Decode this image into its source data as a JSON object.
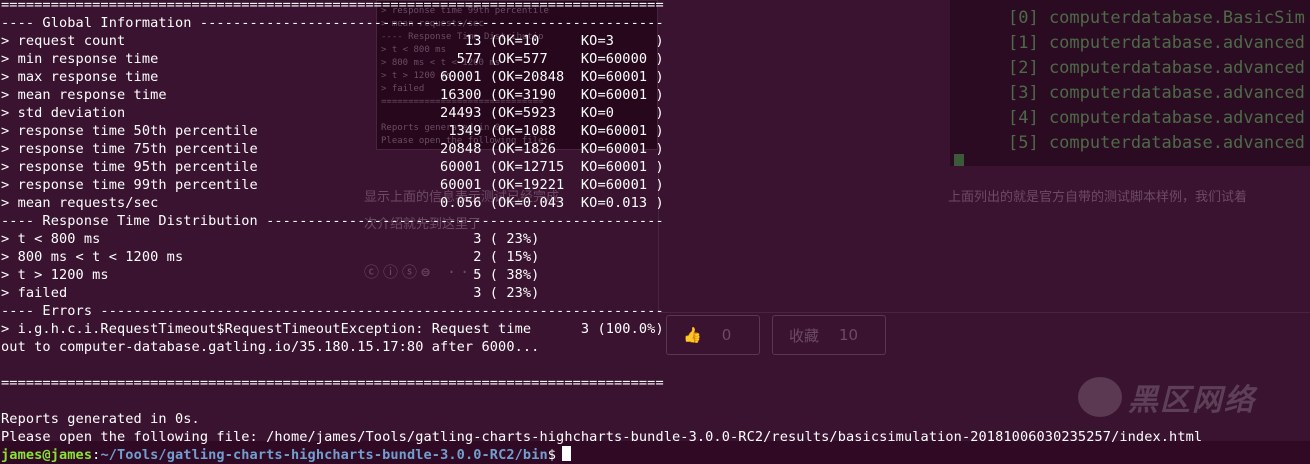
{
  "terminal": {
    "lines": [
      "================================================================================",
      "---- Global Information --------------------------------------------------------",
      "> request count                                         13 (OK=10     KO=3     )",
      "> min response time                                    577 (OK=577    KO=60000 )",
      "> max response time                                  60001 (OK=20848  KO=60001 )",
      "> mean response time                                 16300 (OK=3190   KO=60001 )",
      "> std deviation                                      24493 (OK=5923   KO=0     )",
      "> response time 50th percentile                       1349 (OK=1088   KO=60001 )",
      "> response time 75th percentile                      20848 (OK=1826   KO=60001 )",
      "> response time 95th percentile                      60001 (OK=12715  KO=60001 )",
      "> response time 99th percentile                      60001 (OK=19221  KO=60001 )",
      "> mean requests/sec                                  0.056 (OK=0.043  KO=0.013 )",
      "---- Response Time Distribution ------------------------------------------------",
      "> t < 800 ms                                             3 ( 23%)",
      "> 800 ms < t < 1200 ms                                   2 ( 15%)",
      "> t > 1200 ms                                            5 ( 38%)",
      "> failed                                                 3 ( 23%)",
      "---- Errors --------------------------------------------------------------------",
      "> i.g.h.c.i.RequestTimeout$RequestTimeoutException: Request time      3 (100.0%)",
      "out to computer-database.gatling.io/35.180.15.17:80 after 6000...",
      "",
      "================================================================================",
      "",
      "Reports generated in 0s.",
      "Please open the following file: /home/james/Tools/gatling-charts-highcharts-bundle-3.0.0-RC2/results/basicsimulation-20181006030235257/index.html"
    ],
    "prompt_user": "james@james",
    "prompt_sep": ":",
    "prompt_path": "~/Tools/gatling-charts-highcharts-bundle-3.0.0-RC2/bin",
    "prompt_symbol": "$"
  },
  "background": {
    "inner_terminal_lines": [
      "> response time 99th percentile",
      "> mean requests/sec",
      "---- Response Time Distributio",
      "> t < 800 ms",
      "> 800 ms < t < 1200 ms",
      "> t > 1200 ms",
      "> failed",
      "==============================",
      "",
      "Reports generated in 0s.",
      "Please open the following file:"
    ],
    "right_terminal_lines": [
      "[0] computerdatabase.BasicSim",
      "[1] computerdatabase.advanced",
      "[2] computerdatabase.advanced",
      "[3] computerdatabase.advanced",
      "[4] computerdatabase.advanced",
      "[5] computerdatabase.advanced"
    ],
    "cn_text_left_1": "显示上面的信息表示测试已经完成",
    "cn_text_left_2": "次介绍就先到这里了",
    "cn_text_right": "上面列出的就是官方自带的测试脚本样例，我们试着",
    "cc_icons": "ⓒⓘⓢ⊜  ···",
    "like_count": "0",
    "collect_label": "收藏",
    "collect_count": "10",
    "watermark_text": "黑区网络"
  }
}
